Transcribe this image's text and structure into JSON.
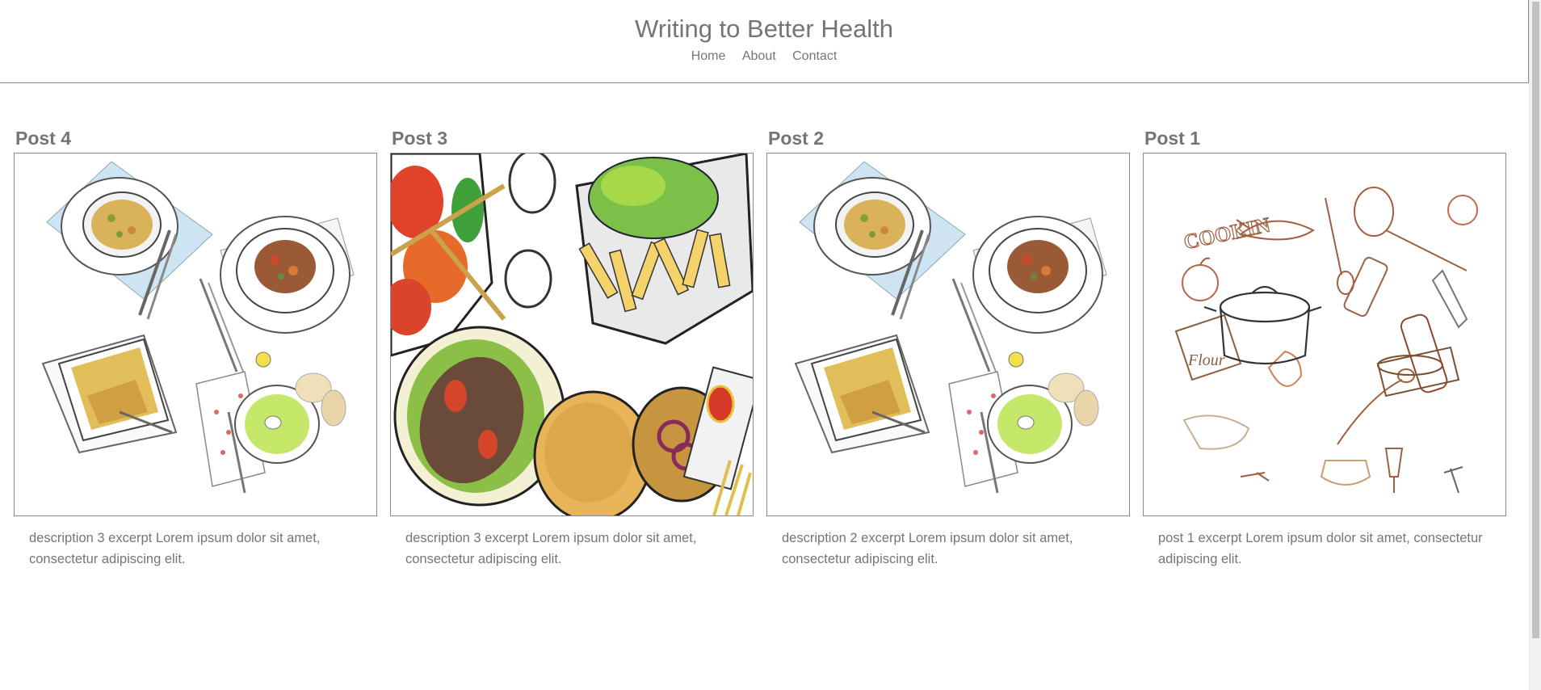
{
  "site": {
    "title": "Writing to Better Health"
  },
  "nav": {
    "items": [
      "Home",
      "About",
      "Contact"
    ]
  },
  "posts": [
    {
      "title": "Post 4",
      "excerpt": "description 3 excerpt Lorem ipsum dolor sit amet, consectetur adipiscing elit.",
      "image": "illustrated-dinner-plates"
    },
    {
      "title": "Post 3",
      "excerpt": "description 3 excerpt Lorem ipsum dolor sit amet, consectetur adipiscing elit.",
      "image": "illustrated-fast-food-picnic"
    },
    {
      "title": "Post 2",
      "excerpt": "description 2 excerpt Lorem ipsum dolor sit amet, consectetur adipiscing elit.",
      "image": "illustrated-dinner-plates"
    },
    {
      "title": "Post 1",
      "excerpt": "post 1 excerpt Lorem ipsum dolor sit amet, consectetur adipiscing elit.",
      "image": "sketched-cooking-items"
    }
  ],
  "images": {
    "cookin_text": "COOKIN",
    "flour_text": "Flour"
  },
  "colors": {
    "text": "#757575",
    "border": "#8a8a8a",
    "accent_green": "#c6e86a",
    "gingham_blue": "#9ecbd9",
    "sketch_brown": "#a0603f"
  }
}
